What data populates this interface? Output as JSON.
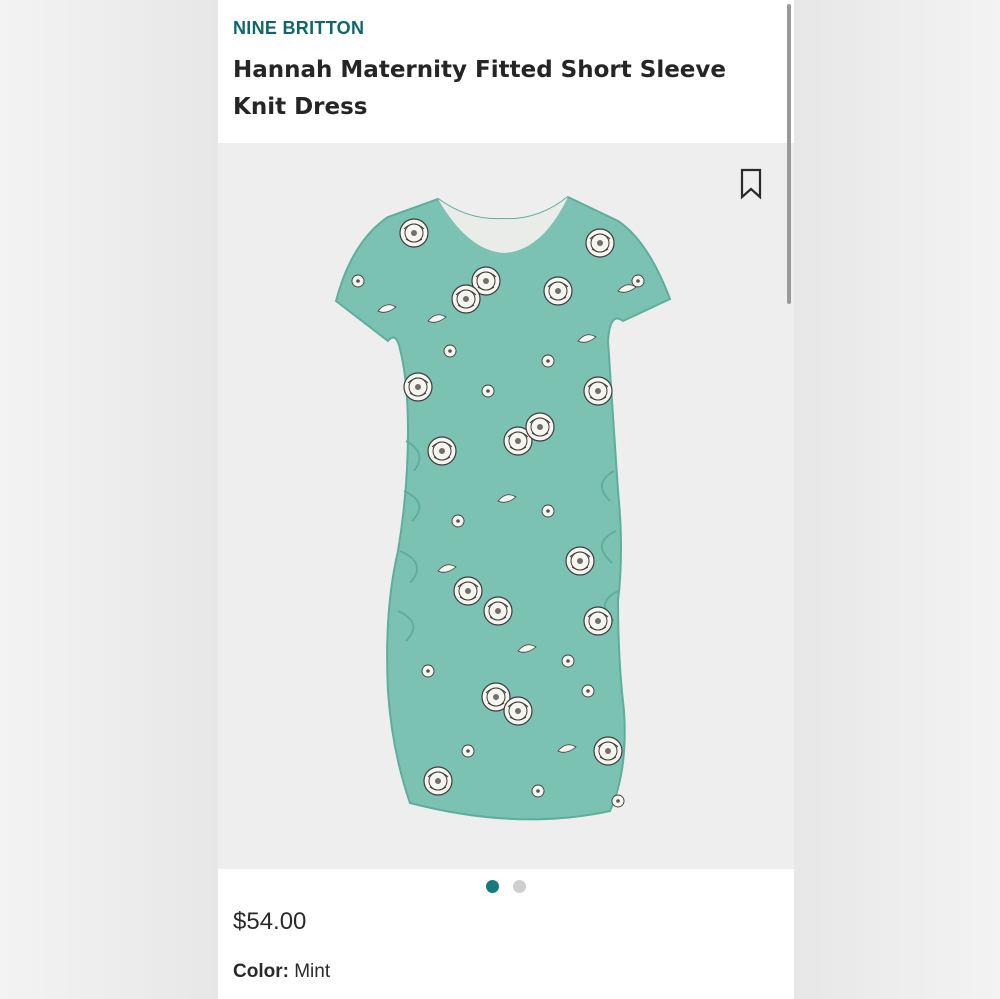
{
  "product": {
    "brand": "NINE BRITTON",
    "title": "Hannah Maternity Fitted Short Sleeve Knit Dress",
    "price": "$54.00",
    "color_label": "Color:",
    "color_value": "Mint"
  },
  "gallery": {
    "bookmark_icon": "bookmark-icon",
    "image_subject": "dress-image",
    "dots": [
      {
        "active": true,
        "color": "#147a7c"
      },
      {
        "active": false,
        "color": "#cfcfcf"
      }
    ]
  },
  "colors": {
    "brand": "#10676b",
    "dress_mint": "#7cc2b2",
    "dress_mint_dark": "#5fae9d",
    "flower_white": "#f7f5ef",
    "flower_line": "#3c3c3c",
    "gallery_bg": "#eeeeee"
  }
}
